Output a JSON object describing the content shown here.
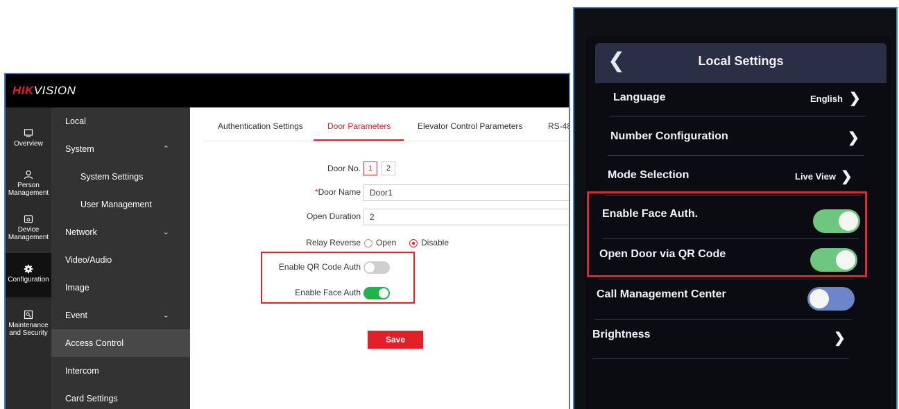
{
  "web": {
    "logo_brand": "HIK",
    "logo_rest": "VISION",
    "icon_nav": [
      {
        "label": "Overview"
      },
      {
        "label": "Person Management"
      },
      {
        "label": "Device Management"
      },
      {
        "label": "Configuration"
      },
      {
        "label": "Maintenance and Security"
      }
    ],
    "menu": {
      "local": "Local",
      "system": "System",
      "system_settings": "System Settings",
      "user_management": "User Management",
      "network": "Network",
      "video_audio": "Video/Audio",
      "image": "Image",
      "event": "Event",
      "access_control": "Access Control",
      "intercom": "Intercom",
      "card_settings": "Card Settings"
    },
    "tabs": {
      "authentication": "Authentication Settings",
      "door_parameters": "Door Parameters",
      "elevator": "Elevator Control Parameters",
      "rs48": "RS-48"
    },
    "form": {
      "door_no_label": "Door No.",
      "door_1": "1",
      "door_2": "2",
      "door_name_required": "*",
      "door_name_label": "Door Name",
      "door_name_value": "Door1",
      "open_duration_label": "Open Duration",
      "open_duration_value": "2",
      "relay_reverse_label": "Relay Reverse",
      "relay_open": "Open",
      "relay_disable": "Disable",
      "qr_label": "Enable QR Code Auth",
      "face_label": "Enable Face Auth",
      "save": "Save"
    }
  },
  "device": {
    "title": "Local Settings",
    "language_label": "Language",
    "language_value": "English",
    "number_config": "Number Configuration",
    "mode_label": "Mode Selection",
    "mode_value": "Live View",
    "face_auth": "Enable Face Auth.",
    "qr_door": "Open Door via QR Code",
    "call_center": "Call Management Center",
    "brightness": "Brightness"
  },
  "colors": {
    "accent_red": "#e1202a",
    "toggle_green": "#22b24c",
    "device_green": "#6dc77e",
    "device_blue": "#6c86c9"
  }
}
